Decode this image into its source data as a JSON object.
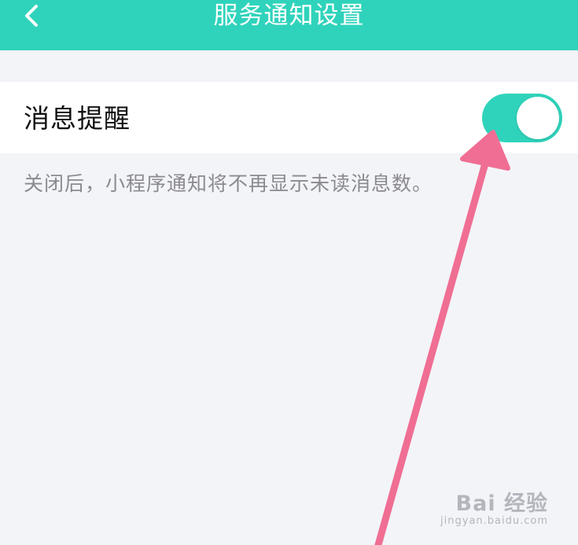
{
  "header": {
    "title": "服务通知设置",
    "back_icon": "chevron-left-icon",
    "background_color": "#2fd3bb"
  },
  "settings": {
    "message_reminder": {
      "label": "消息提醒",
      "enabled": true,
      "toggle_color": "#2fd3bb"
    },
    "hint": "关闭后，小程序通知将不再显示未读消息数。"
  },
  "annotation": {
    "arrow_color": "#f06e93"
  },
  "watermark": {
    "logo": "Bai 经验",
    "url": "jingyan.baidu.com"
  }
}
